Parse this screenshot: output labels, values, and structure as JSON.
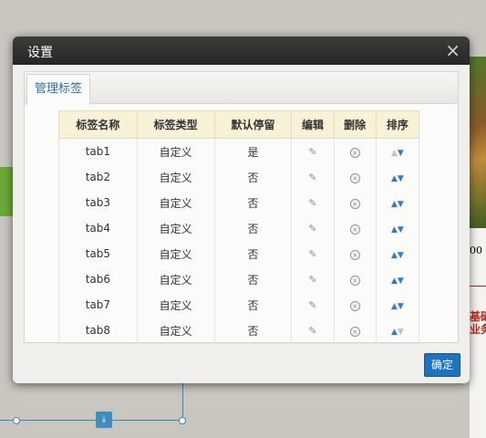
{
  "dialog": {
    "title": "设置",
    "close_symbol": "×",
    "tab_label": "管理标签",
    "ok_label": "确定"
  },
  "table": {
    "headers": [
      "标签名称",
      "标签类型",
      "默认停留",
      "编辑",
      "删除",
      "排序"
    ],
    "rows": [
      {
        "name": "tab1",
        "type": "自定义",
        "default": "是",
        "up": false,
        "down": true
      },
      {
        "name": "tab2",
        "type": "自定义",
        "default": "否",
        "up": true,
        "down": true
      },
      {
        "name": "tab3",
        "type": "自定义",
        "default": "否",
        "up": true,
        "down": true
      },
      {
        "name": "tab4",
        "type": "自定义",
        "default": "否",
        "up": true,
        "down": true
      },
      {
        "name": "tab5",
        "type": "自定义",
        "default": "否",
        "up": true,
        "down": true
      },
      {
        "name": "tab6",
        "type": "自定义",
        "default": "否",
        "up": true,
        "down": true
      },
      {
        "name": "tab7",
        "type": "自定义",
        "default": "否",
        "up": true,
        "down": true
      },
      {
        "name": "tab8",
        "type": "自定义",
        "default": "否",
        "up": true,
        "down": false
      }
    ],
    "icons": {
      "edit": "edit-icon",
      "delete": "delete-icon",
      "up": "arrow-up-icon",
      "down": "arrow-down-icon"
    }
  },
  "background": {
    "right_fragment_1": "基础",
    "right_fragment_2": "业务",
    "right_fragment_0": "00",
    "handle_icon": "download-icon"
  },
  "colors": {
    "accent": "#1d73bf",
    "tab_text": "#2b6fa6",
    "header_bg": "#f8f1d6",
    "arrow_active": "#2f7fc4"
  }
}
